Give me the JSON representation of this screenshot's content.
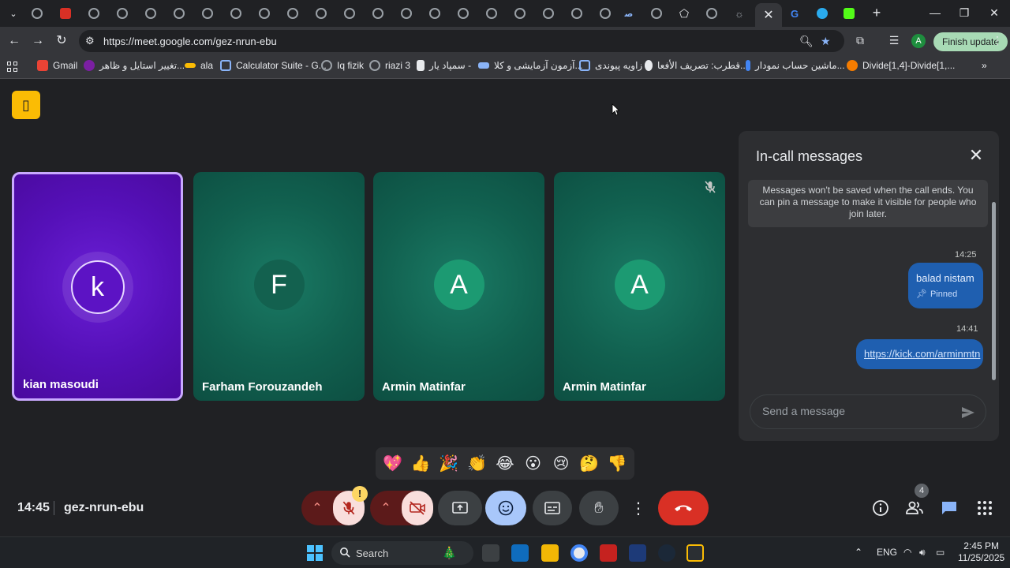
{
  "browser": {
    "url": "https://meet.google.com/gez-nrun-ebu",
    "finish_update_label": "Finish update",
    "profile_initial": "A",
    "bookmarks": [
      {
        "label": "Gmail"
      },
      {
        "label": "تغییر استایل و ظاهر..."
      },
      {
        "label": "ala"
      },
      {
        "label": "Calculator Suite - G..."
      },
      {
        "label": "Iq fizik"
      },
      {
        "label": "riazi 3"
      },
      {
        "label": "سمپاد یار -"
      },
      {
        "label": "آزمون آزمایشی و کلا..."
      },
      {
        "label": "زاویه پیوندی"
      },
      {
        "label": "قطرب: تصریف الأفعا..."
      },
      {
        "label": "ماشین حساب نمودار..."
      },
      {
        "label": "Divide[1,4]-Divide[1,..."
      }
    ]
  },
  "meet": {
    "participants": [
      {
        "name": "kian masoudi",
        "initial": "k"
      },
      {
        "name": "Farham Forouzandeh",
        "initial": "F"
      },
      {
        "name": "Armin Matinfar",
        "initial": "A"
      },
      {
        "name": "Armin Matinfar",
        "initial": "A"
      }
    ],
    "chat": {
      "title": "In-call messages",
      "notice": "Messages won't be saved when the call ends. You can pin a message to make it visible for people who join later.",
      "messages": [
        {
          "time": "14:25",
          "text": "balad nistam",
          "pinned_label": "Pinned"
        },
        {
          "time": "14:41",
          "text": "https://kick.com/arminmtn"
        }
      ],
      "input_placeholder": "Send a message"
    },
    "reactions": [
      "💖",
      "👍",
      "🎉",
      "👏",
      "😂",
      "😮",
      "😢",
      "🤔",
      "👎"
    ],
    "time": "14:45",
    "meeting_code": "gez-nrun-ebu",
    "warning_badge": "!",
    "people_count": "4"
  },
  "taskbar": {
    "search_label": "Search",
    "language": "ENG",
    "time": "2:45 PM",
    "date": "11/25/2025"
  },
  "colors": {
    "tile_green": "#11604f",
    "tile_purple": "#5510b8",
    "end_call": "#d93025",
    "chat_bubble": "#1f5fb0",
    "active_control": "#a8c7fa"
  }
}
